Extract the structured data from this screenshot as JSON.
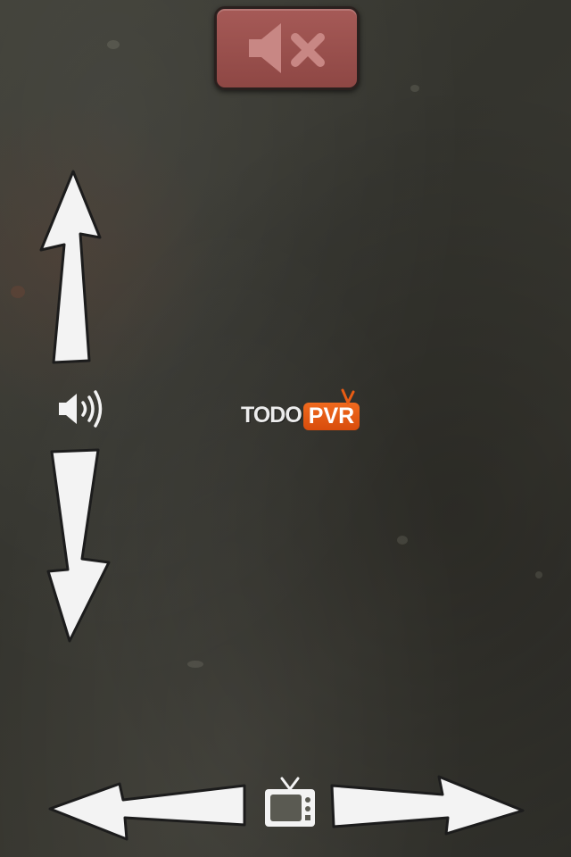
{
  "logo": {
    "todo_text": "TODO",
    "pvr_text": "PVR",
    "brand_color": "#e85c14"
  },
  "controls": {
    "mute_button": {
      "icon": "speaker-mute-icon",
      "color": "#9a4f4c"
    },
    "volume_up": {
      "icon": "arrow-up-icon"
    },
    "volume_label": {
      "icon": "speaker-volume-icon"
    },
    "volume_down": {
      "icon": "arrow-down-icon"
    },
    "channel_previous": {
      "icon": "arrow-left-icon"
    },
    "tv_button": {
      "icon": "tv-icon"
    },
    "channel_next": {
      "icon": "arrow-right-icon"
    }
  }
}
